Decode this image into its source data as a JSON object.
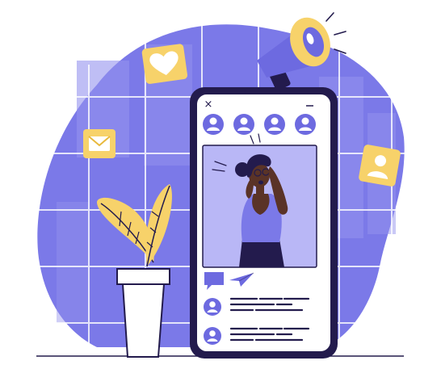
{
  "colors": {
    "blob": "#7b79e8",
    "blob_light": "#9593ee",
    "grid": "#ffffff",
    "phone_frame": "#231b4d",
    "phone_screen": "#ffffff",
    "accent": "#6d6ae0",
    "accent_light": "#b9b7f6",
    "yellow": "#f7d26a",
    "yellow_dark": "#e8b93c",
    "skin": "#5a3327",
    "hair": "#231b4d",
    "shirt": "#7b79e8",
    "text_line": "#231b4d",
    "pot": "#ffffff"
  },
  "icons": {
    "heart_badge": "heart-icon",
    "mail_badge": "envelope-icon",
    "user_badge": "user-icon",
    "megaphone": "megaphone-icon",
    "stories": [
      "avatar-icon",
      "avatar-icon",
      "avatar-icon",
      "avatar-icon"
    ],
    "comment": "chat-bubble-icon",
    "share": "paper-plane-icon",
    "close": "close-icon",
    "minimize": "minimize-icon"
  },
  "phone": {
    "close_glyph": "×"
  }
}
